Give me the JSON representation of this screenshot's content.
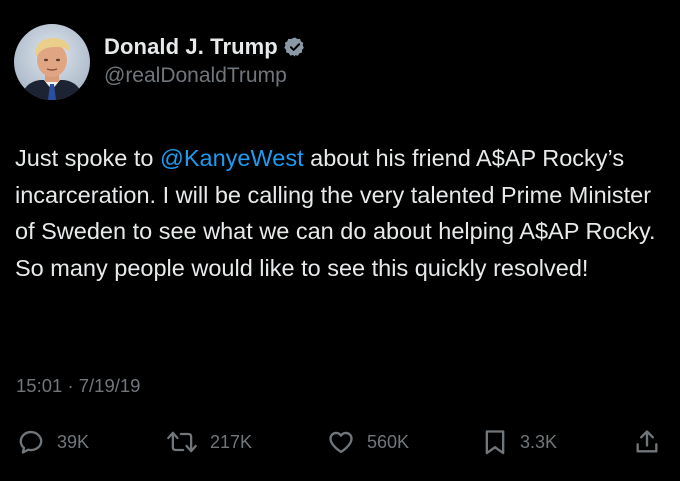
{
  "author": {
    "display_name": "Donald J. Trump",
    "handle": "@realDonaldTrump",
    "verified": true
  },
  "tweet": {
    "text_before_mention": "Just spoke to ",
    "mention": "@KanyeWest",
    "text_after_mention": " about his friend A$AP Rocky’s incarceration. I will be calling the very talented Prime Minister of Sweden to see what we can do about helping A$AP Rocky. So many people would like to see this quickly resolved!"
  },
  "meta": {
    "time": "15:01",
    "separator": "·",
    "date": "7/19/19"
  },
  "actions": {
    "replies": "39K",
    "retweets": "217K",
    "likes": "560K",
    "bookmarks": "3.3K"
  },
  "colors": {
    "background": "#000000",
    "text": "#e7e9ea",
    "secondary": "#71767b",
    "accent": "#1d9bf0"
  },
  "icons": [
    "verified-badge-icon",
    "reply-icon",
    "retweet-icon",
    "like-icon",
    "bookmark-icon",
    "share-icon"
  ]
}
